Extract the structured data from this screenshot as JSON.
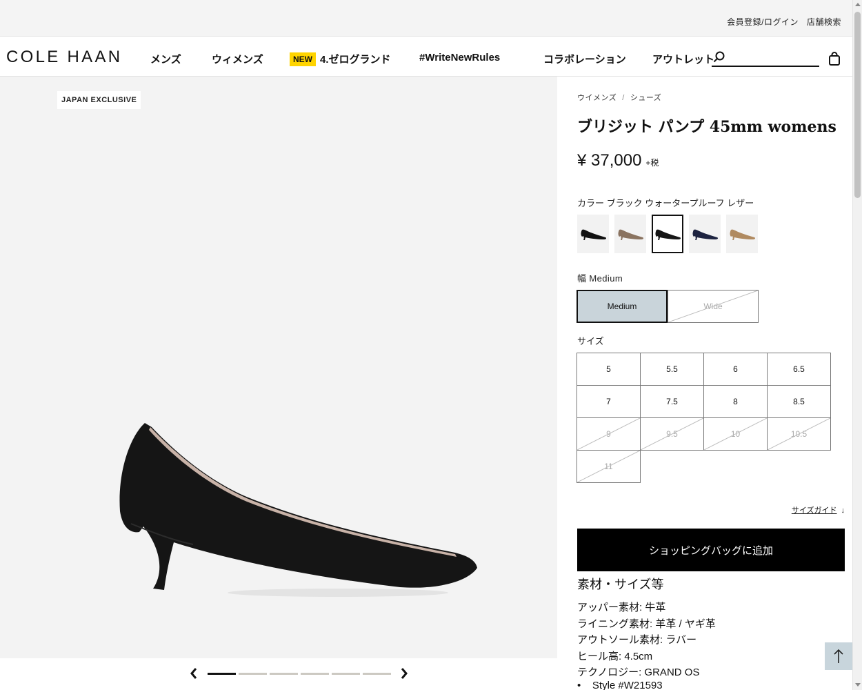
{
  "utility": {
    "login": "会員登録/ログイン",
    "store_locator": "店舗検索"
  },
  "nav": {
    "logo": "COLE HAAN",
    "items": [
      "メンズ",
      "ウィメンズ",
      "4.ゼログランド",
      "#WriteNewRules",
      "コラボレーション",
      "アウトレット"
    ],
    "new_badge": "NEW",
    "search_placeholder": "",
    "search_icon": "search-icon",
    "bag_icon": "shopping-bag-icon"
  },
  "gallery": {
    "badge": "JAPAN EXCLUSIVE",
    "slide_count": 6,
    "active_slide": 1
  },
  "product": {
    "breadcrumb": [
      "ウイメンズ",
      "シューズ"
    ],
    "breadcrumb_sep": "/",
    "title": "ブリジット パンプ 45mm womens",
    "price": "¥ 37,000",
    "price_tax": "+税",
    "color_label": "カラー ブラック ウォータープルーフ レザー",
    "swatches": [
      {
        "color": "#111111",
        "selected": false
      },
      {
        "color": "#8a7360",
        "selected": false
      },
      {
        "color": "#161616",
        "selected": true
      },
      {
        "color": "#1d2340",
        "selected": false
      },
      {
        "color": "#b08a60",
        "selected": false
      }
    ],
    "width_label": "幅 Medium",
    "widths": [
      {
        "label": "Medium",
        "selected": true,
        "available": true
      },
      {
        "label": "Wide",
        "selected": false,
        "available": false
      }
    ],
    "size_label": "サイズ",
    "sizes": [
      {
        "label": "5",
        "available": true
      },
      {
        "label": "5.5",
        "available": true
      },
      {
        "label": "6",
        "available": true
      },
      {
        "label": "6.5",
        "available": true
      },
      {
        "label": "7",
        "available": true
      },
      {
        "label": "7.5",
        "available": true
      },
      {
        "label": "8",
        "available": true
      },
      {
        "label": "8.5",
        "available": true
      },
      {
        "label": "9",
        "available": false
      },
      {
        "label": "9.5",
        "available": false
      },
      {
        "label": "10",
        "available": false
      },
      {
        "label": "10.5",
        "available": false
      },
      {
        "label": "11",
        "available": false
      }
    ],
    "size_guide": "サイズガイド",
    "size_guide_arrow": "↓",
    "add_to_bag": "ショッピングバッグに追加",
    "spec_title": "素材・サイズ等",
    "specs": [
      "アッパー素材: 牛革",
      "ライニング素材: 羊革 / ヤギ革",
      "アウトソール素材: ラバー",
      "ヒール高: 4.5cm",
      "テクノロジー: GRAND OS"
    ],
    "spec_partial": "Style #W21593"
  },
  "colors": {
    "accent_badge": "#ffd400",
    "selected_width": "#c9d4da",
    "cta": "#000000"
  }
}
